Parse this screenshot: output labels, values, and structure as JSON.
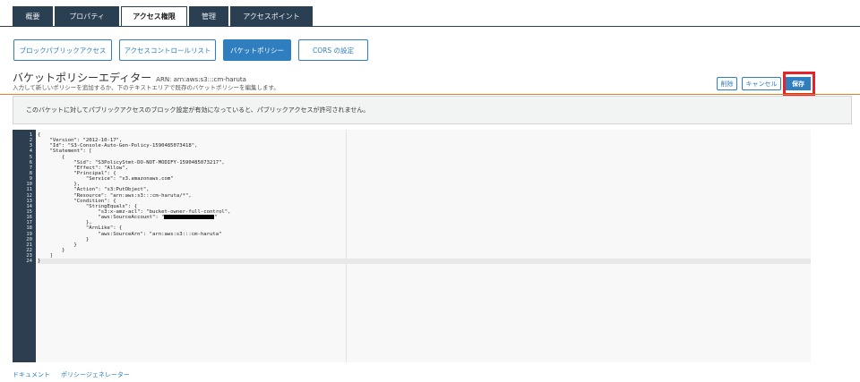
{
  "tabs": [
    {
      "label": "概要"
    },
    {
      "label": "プロパティ"
    },
    {
      "label": "アクセス権限"
    },
    {
      "label": "管理"
    },
    {
      "label": "アクセスポイント"
    }
  ],
  "subtabs": [
    {
      "label": "ブロックパブリックアクセス"
    },
    {
      "label": "アクセスコントロールリスト"
    },
    {
      "label": "バケットポリシー"
    },
    {
      "label": "CORS の設定"
    }
  ],
  "editor": {
    "title": "バケットポリシーエディター",
    "arn": "ARN: arn:aws:s3:::cm-haruta",
    "description": "入力して新しいポリシーを追加するか、下のテキストエリアで既存のバケットポリシーを編集します。"
  },
  "actions": {
    "delete": "削除",
    "cancel": "キャンセル",
    "save": "保存"
  },
  "notice": "このバケットに対してパブリックアクセスのブロック設定が有効になっていると、パブリックアクセスが許可されません。",
  "code": {
    "line_numbers": [
      "1",
      "2",
      "3",
      "4",
      "5",
      "6",
      "7",
      "8",
      "9",
      "10",
      "11",
      "12",
      "13",
      "14",
      "15",
      "16",
      "17",
      "18",
      "19",
      "20",
      "21",
      "22",
      "23",
      "24"
    ],
    "lines": [
      "{",
      "    \"Version\": \"2012-10-17\",",
      "    \"Id\": \"S3-Console-Auto-Gen-Policy-1590485073418\",",
      "    \"Statement\": [",
      "        {",
      "            \"Sid\": \"S3PolicyStmt-DO-NOT-MODIFY-1590485073217\",",
      "            \"Effect\": \"Allow\",",
      "            \"Principal\": {",
      "                \"Service\": \"s3.amazonaws.com\"",
      "            },",
      "            \"Action\": \"s3:PutObject\",",
      "            \"Resource\": \"arn:aws:s3:::cm-haruta/*\",",
      "            \"Condition\": {",
      "                \"StringEquals\": {",
      "                    \"s3:x-amz-acl\": \"bucket-owner-full-control\",",
      "                    \"aws:SourceAccount\": \"",
      "                },",
      "                \"ArnLike\": {",
      "                    \"aws:SourceArn\": \"arn:aws:s3:::cm-haruta\"",
      "                }",
      "            }",
      "        }",
      "    ]",
      "}"
    ],
    "redacted_suffix": "\""
  },
  "footer": {
    "docs": "ドキュメント",
    "generator": "ポリシージェネレーター"
  }
}
